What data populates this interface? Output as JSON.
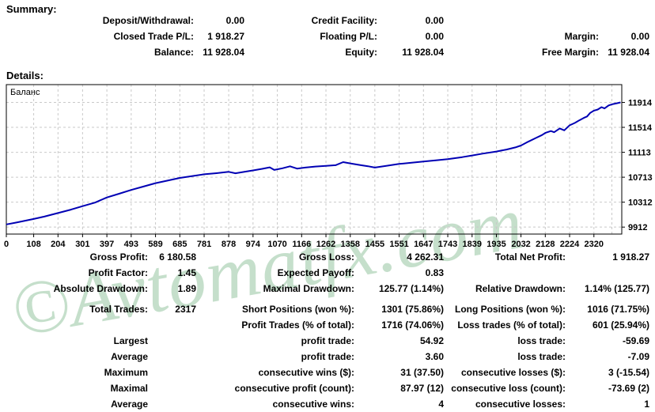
{
  "summary": {
    "heading": "Summary:",
    "rows": [
      [
        {
          "label": "Deposit/Withdrawal:",
          "value": "0.00"
        },
        {
          "label": "Credit Facility:",
          "value": "0.00"
        },
        {
          "label": "",
          "value": ""
        }
      ],
      [
        {
          "label": "Closed Trade P/L:",
          "value": "1 918.27"
        },
        {
          "label": "Floating P/L:",
          "value": "0.00"
        },
        {
          "label": "Margin:",
          "value": "0.00"
        }
      ],
      [
        {
          "label": "Balance:",
          "value": "11 928.04"
        },
        {
          "label": "Equity:",
          "value": "11 928.04"
        },
        {
          "label": "Free Margin:",
          "value": "11 928.04"
        }
      ]
    ]
  },
  "details": {
    "heading": "Details:"
  },
  "chart_data": {
    "type": "line",
    "title": "",
    "legend": "Баланс",
    "xlabel": "",
    "ylabel": "",
    "grid": true,
    "legend_position": "top-left-inside",
    "x_ticks": [
      0,
      108,
      204,
      301,
      397,
      493,
      589,
      685,
      781,
      878,
      974,
      1070,
      1166,
      1262,
      1358,
      1455,
      1551,
      1647,
      1743,
      1839,
      1935,
      2032,
      2128,
      2224,
      2320
    ],
    "y_ticks": [
      9912,
      10312,
      10713,
      11113,
      11514,
      11914
    ],
    "xlim": [
      0,
      2430
    ],
    "ylim": [
      9800,
      12200
    ],
    "line_color": "#0000b4",
    "grid_color": "#c9c9c9",
    "series": [
      {
        "name": "Баланс",
        "points": [
          [
            0,
            9955
          ],
          [
            40,
            9985
          ],
          [
            108,
            10042
          ],
          [
            150,
            10080
          ],
          [
            204,
            10138
          ],
          [
            255,
            10192
          ],
          [
            301,
            10248
          ],
          [
            350,
            10305
          ],
          [
            397,
            10388
          ],
          [
            445,
            10448
          ],
          [
            493,
            10508
          ],
          [
            540,
            10562
          ],
          [
            589,
            10618
          ],
          [
            640,
            10662
          ],
          [
            685,
            10702
          ],
          [
            735,
            10732
          ],
          [
            781,
            10760
          ],
          [
            830,
            10778
          ],
          [
            878,
            10800
          ],
          [
            905,
            10776
          ],
          [
            940,
            10800
          ],
          [
            974,
            10822
          ],
          [
            1010,
            10848
          ],
          [
            1040,
            10872
          ],
          [
            1058,
            10830
          ],
          [
            1090,
            10856
          ],
          [
            1120,
            10888
          ],
          [
            1148,
            10852
          ],
          [
            1180,
            10868
          ],
          [
            1220,
            10884
          ],
          [
            1262,
            10896
          ],
          [
            1300,
            10906
          ],
          [
            1330,
            10956
          ],
          [
            1362,
            10932
          ],
          [
            1400,
            10906
          ],
          [
            1428,
            10890
          ],
          [
            1455,
            10868
          ],
          [
            1500,
            10896
          ],
          [
            1551,
            10926
          ],
          [
            1600,
            10946
          ],
          [
            1647,
            10966
          ],
          [
            1700,
            10986
          ],
          [
            1743,
            11002
          ],
          [
            1800,
            11036
          ],
          [
            1839,
            11062
          ],
          [
            1880,
            11092
          ],
          [
            1935,
            11126
          ],
          [
            1975,
            11158
          ],
          [
            2010,
            11192
          ],
          [
            2032,
            11222
          ],
          [
            2060,
            11282
          ],
          [
            2090,
            11342
          ],
          [
            2115,
            11390
          ],
          [
            2128,
            11424
          ],
          [
            2150,
            11455
          ],
          [
            2163,
            11436
          ],
          [
            2185,
            11496
          ],
          [
            2203,
            11466
          ],
          [
            2224,
            11546
          ],
          [
            2245,
            11586
          ],
          [
            2262,
            11626
          ],
          [
            2280,
            11666
          ],
          [
            2293,
            11688
          ],
          [
            2305,
            11745
          ],
          [
            2320,
            11782
          ],
          [
            2335,
            11800
          ],
          [
            2350,
            11838
          ],
          [
            2362,
            11818
          ],
          [
            2378,
            11866
          ],
          [
            2395,
            11888
          ],
          [
            2412,
            11902
          ],
          [
            2425,
            11914
          ]
        ]
      }
    ]
  },
  "stats": {
    "rows": [
      [
        {
          "label": "Gross Profit:",
          "value": "6 180.58"
        },
        {
          "label": "Gross Loss:",
          "value": "4 262.31"
        },
        {
          "label": "Total Net Profit:",
          "value": "1 918.27"
        }
      ],
      [
        {
          "label": "Profit Factor:",
          "value": "1.45"
        },
        {
          "label": "Expected Payoff:",
          "value": "0.83"
        },
        {
          "label": "",
          "value": ""
        }
      ],
      [
        {
          "label": "Absolute Drawdown:",
          "value": "1.89"
        },
        {
          "label": "Maximal Drawdown:",
          "value": "125.77 (1.14%)"
        },
        {
          "label": "Relative Drawdown:",
          "value": "1.14% (125.77)"
        }
      ],
      [
        {
          "label": "Total Trades:",
          "value": "2317"
        },
        {
          "label": "Short Positions (won %):",
          "value": "1301 (75.86%)"
        },
        {
          "label": "Long Positions (won %):",
          "value": "1016 (71.75%)"
        }
      ],
      [
        {
          "label": "",
          "value": ""
        },
        {
          "label": "Profit Trades (% of total):",
          "value": "1716 (74.06%)"
        },
        {
          "label": "Loss trades (% of total):",
          "value": "601 (25.94%)"
        }
      ],
      [
        {
          "label": "Largest",
          "value": ""
        },
        {
          "label": "profit trade:",
          "value": "54.92"
        },
        {
          "label": "loss trade:",
          "value": "-59.69"
        }
      ],
      [
        {
          "label": "Average",
          "value": ""
        },
        {
          "label": "profit trade:",
          "value": "3.60"
        },
        {
          "label": "loss trade:",
          "value": "-7.09"
        }
      ],
      [
        {
          "label": "Maximum",
          "value": ""
        },
        {
          "label": "consecutive wins ($):",
          "value": "31 (37.50)"
        },
        {
          "label": "consecutive losses ($):",
          "value": "3 (-15.54)"
        }
      ],
      [
        {
          "label": "Maximal",
          "value": ""
        },
        {
          "label": "consecutive profit (count):",
          "value": "87.97 (12)"
        },
        {
          "label": "consecutive loss (count):",
          "value": "-73.69 (2)"
        }
      ],
      [
        {
          "label": "Average",
          "value": ""
        },
        {
          "label": "consecutive wins:",
          "value": "4"
        },
        {
          "label": "consecutive losses:",
          "value": "1"
        }
      ]
    ],
    "gap_after_row_index": 2
  },
  "watermark": {
    "text": "©Avtomatfx.com",
    "color": "rgba(150,196,160,0.55)"
  }
}
